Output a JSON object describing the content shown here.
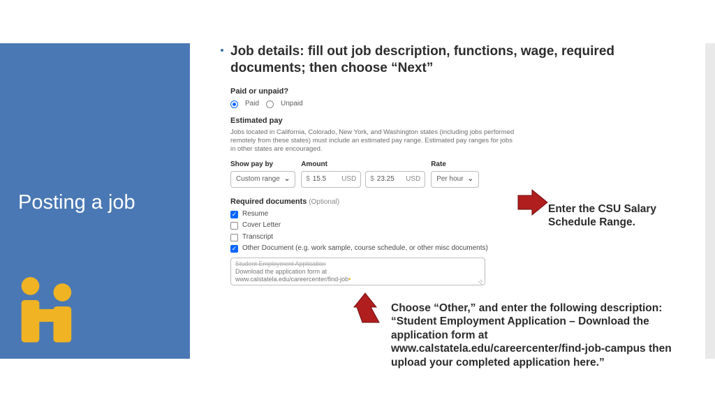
{
  "sidebar": {
    "title": "Posting a job"
  },
  "bullet": {
    "text": "Job details: fill out job description, functions, wage, required documents; then choose “Next”"
  },
  "form": {
    "paid_label": "Paid or unpaid?",
    "paid_option": "Paid",
    "unpaid_option": "Unpaid",
    "estimated_label": "Estimated pay",
    "estimated_help": "Jobs located in California, Colorado, New York, and Washington states (including jobs performed remotely from these states) must include an estimated pay range. Estimated pay ranges for jobs in other states are encouraged.",
    "show_pay_by_label": "Show pay by",
    "show_pay_by_value": "Custom range",
    "amount_label": "Amount",
    "currency": "$",
    "amount_low": "15.5",
    "amount_high": "23.25",
    "usd": "USD",
    "rate_label": "Rate",
    "rate_value": "Per hour",
    "docs_label": "Required documents",
    "docs_optional": "(Optional)",
    "doc_resume": "Resume",
    "doc_cover": "Cover Letter",
    "doc_transcript": "Transcript",
    "doc_other": "Other Document (e.g. work sample, course schedule, or other misc documents)",
    "textarea_line1": "Student Employment Application",
    "textarea_line2": "Download the application form at",
    "textarea_line3": "www.calstatela.edu/careercenter/find-job"
  },
  "annotations": {
    "right": "Enter the CSU Salary Schedule Range.",
    "bottom": "Choose “Other,” and enter the following description: “Student Employment Application – Download the application form at www.calstatela.edu/careercenter/find-job-campus then upload your completed application here.”"
  }
}
